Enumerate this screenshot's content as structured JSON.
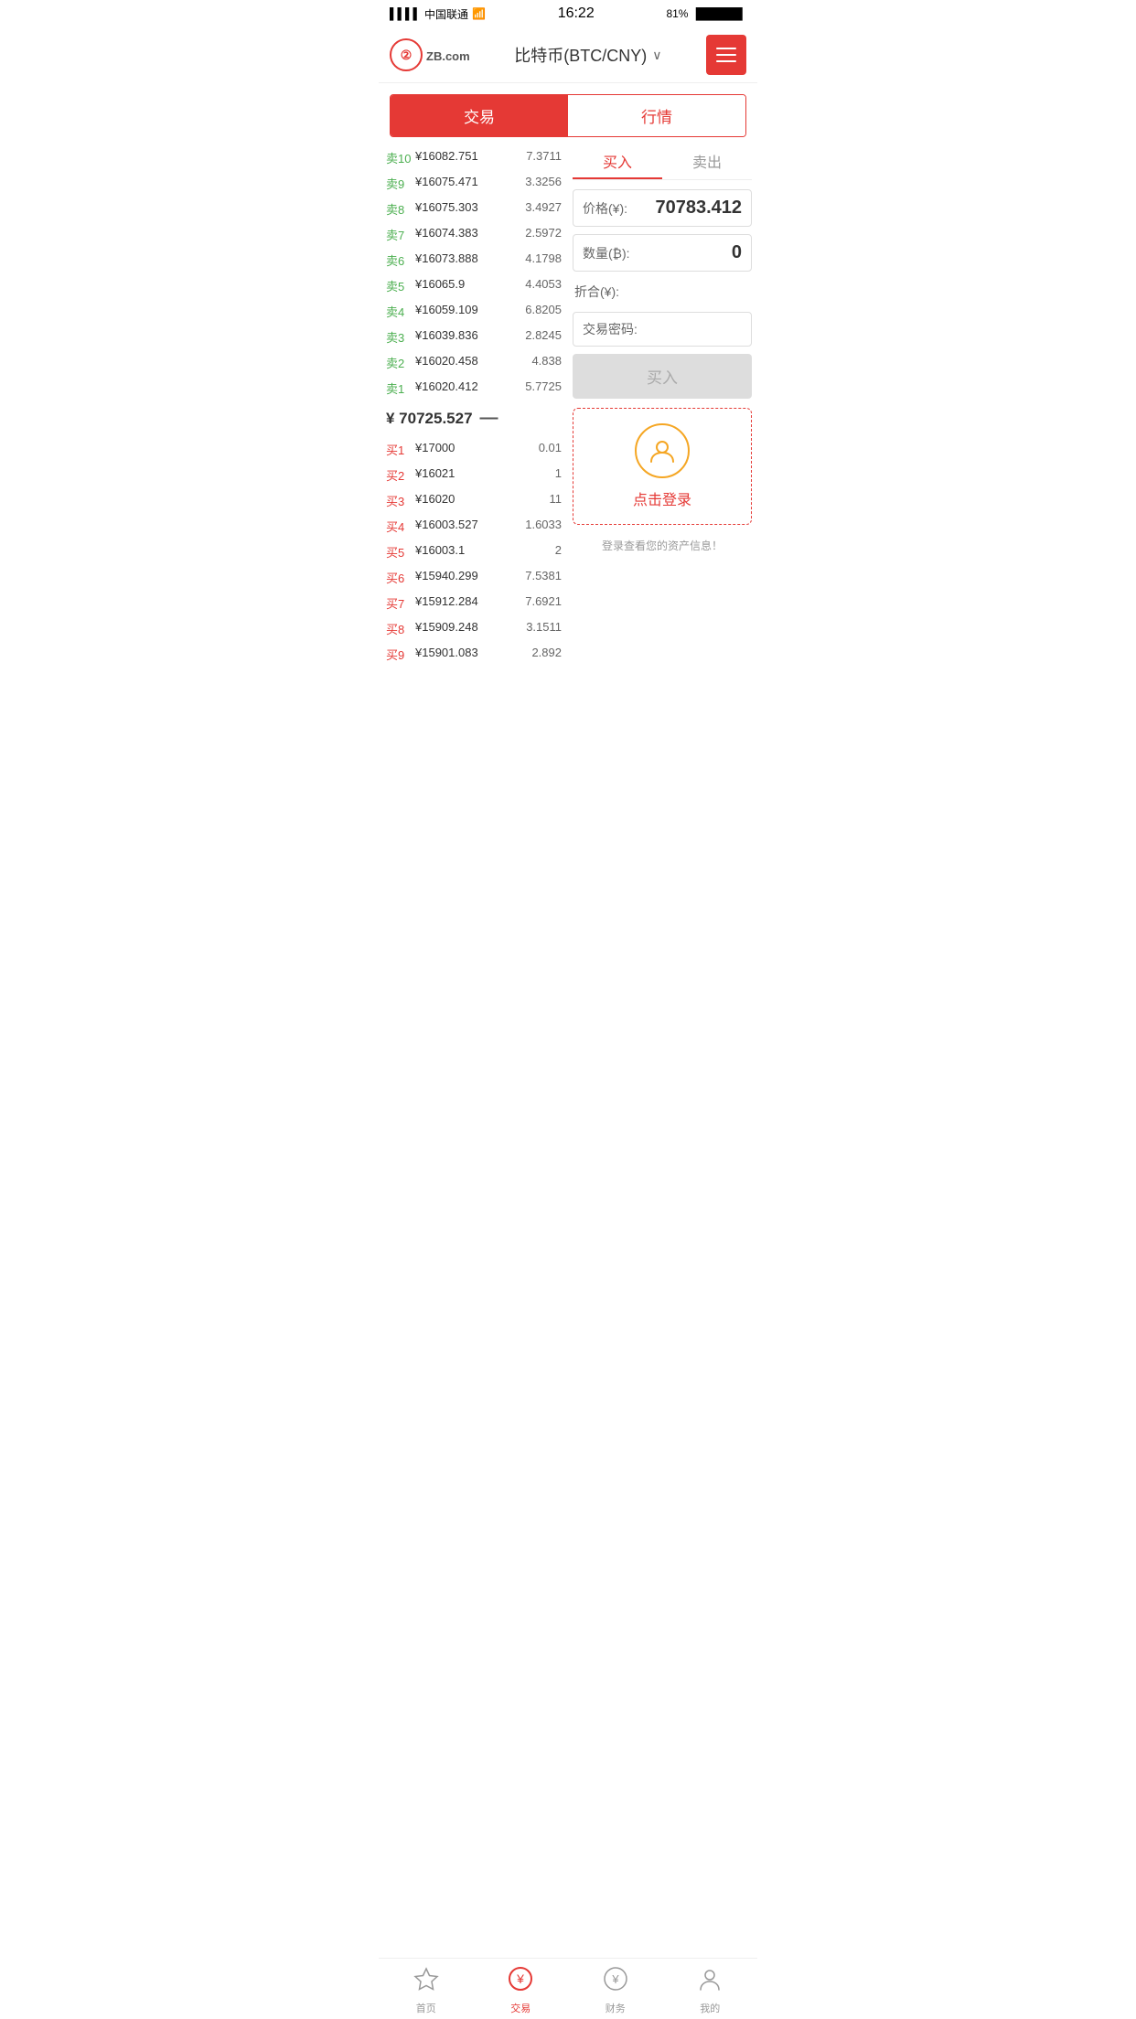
{
  "statusBar": {
    "carrier": "中国联通",
    "time": "16:22",
    "battery": "81%"
  },
  "header": {
    "logoText": "ZB",
    "logoDomain": ".com",
    "title": "比特币(BTC/CNY)",
    "menuLabel": "menu"
  },
  "tabs": [
    {
      "id": "trade",
      "label": "交易",
      "active": true
    },
    {
      "id": "market",
      "label": "行情",
      "active": false
    }
  ],
  "orderBook": {
    "sells": [
      {
        "label": "卖10",
        "price": "¥16082.751",
        "amount": "7.3711"
      },
      {
        "label": "卖9",
        "price": "¥16075.471",
        "amount": "3.3256"
      },
      {
        "label": "卖8",
        "price": "¥16075.303",
        "amount": "3.4927"
      },
      {
        "label": "卖7",
        "price": "¥16074.383",
        "amount": "2.5972"
      },
      {
        "label": "卖6",
        "price": "¥16073.888",
        "amount": "4.1798"
      },
      {
        "label": "卖5",
        "price": "¥16065.9",
        "amount": "4.4053"
      },
      {
        "label": "卖4",
        "price": "¥16059.109",
        "amount": "6.8205"
      },
      {
        "label": "卖3",
        "price": "¥16039.836",
        "amount": "2.8245"
      },
      {
        "label": "卖2",
        "price": "¥16020.458",
        "amount": "4.838"
      },
      {
        "label": "卖1",
        "price": "¥16020.412",
        "amount": "5.7725"
      }
    ],
    "currentPrice": "¥ 70725.527",
    "currentIcon": "—",
    "buys": [
      {
        "label": "买1",
        "price": "¥17000",
        "amount": "0.01"
      },
      {
        "label": "买2",
        "price": "¥16021",
        "amount": "1"
      },
      {
        "label": "买3",
        "price": "¥16020",
        "amount": "11"
      },
      {
        "label": "买4",
        "price": "¥16003.527",
        "amount": "1.6033"
      },
      {
        "label": "买5",
        "price": "¥16003.1",
        "amount": "2"
      },
      {
        "label": "买6",
        "price": "¥15940.299",
        "amount": "7.5381"
      },
      {
        "label": "买7",
        "price": "¥15912.284",
        "amount": "7.6921"
      },
      {
        "label": "买8",
        "price": "¥15909.248",
        "amount": "3.1511"
      },
      {
        "label": "买9",
        "price": "¥15901.083",
        "amount": "2.892"
      }
    ]
  },
  "tradePanel": {
    "buyTab": "买入",
    "sellTab": "卖出",
    "priceLabel": "价格(¥):",
    "priceValue": "70783.412",
    "amountLabel": "数量(₿):",
    "amountValue": "0",
    "totalLabel": "折合(¥):",
    "totalValue": "",
    "passwordLabel": "交易密码:",
    "buyButton": "买入",
    "loginBoxText": "点击登录",
    "loginSubText": "登录查看您的资产信息！"
  },
  "bottomNav": [
    {
      "id": "home",
      "label": "首页",
      "active": false
    },
    {
      "id": "trade",
      "label": "交易",
      "active": true
    },
    {
      "id": "finance",
      "label": "财务",
      "active": false
    },
    {
      "id": "mine",
      "label": "我的",
      "active": false
    }
  ]
}
